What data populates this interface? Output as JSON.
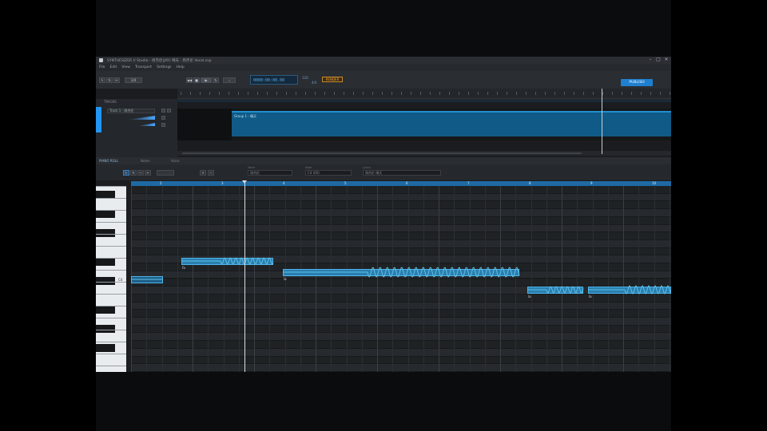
{
  "app": {
    "title": "SYNTHESIZER V Studio - 周杰伦(JAY) 晴天 · 周杰伦 Vocal.svp",
    "menus": [
      "File",
      "Edit",
      "View",
      "Transport",
      "Settings",
      "Help"
    ],
    "window_controls": [
      "–",
      "□",
      "✕"
    ]
  },
  "toolbar": {
    "time_display": "0000:00:00.00",
    "tempo": "120",
    "time_sig": "4/4",
    "snap_label": "1/4",
    "status": "RENDER",
    "publish_label": "PUBLISH"
  },
  "arrangement": {
    "track_panel_label": "TRACKS",
    "track_name": "Track 1 - 周杰伦",
    "clip_label": "Group 1 - 晴天"
  },
  "editor": {
    "tabs": [
      "PIANO ROLL",
      "Notes",
      "Voice"
    ],
    "fields": [
      {
        "label": "Voice",
        "value": "周杰伦"
      },
      {
        "label": "Note",
        "value": "C4 (60)"
      },
      {
        "label": "Lyrics",
        "value": "周杰伦 晴天"
      }
    ],
    "ruler_labels": [
      "2",
      "3",
      "4",
      "5",
      "6",
      "7",
      "8",
      "9",
      "10"
    ],
    "piano_label": "C4",
    "lyrics": [
      "fa",
      "la",
      "la",
      "la"
    ]
  },
  "colors": {
    "accent": "#1f7fd0",
    "note": "#2a7fb0",
    "pitch_curve": "#5ec0e6",
    "warning": "#f0a030"
  }
}
